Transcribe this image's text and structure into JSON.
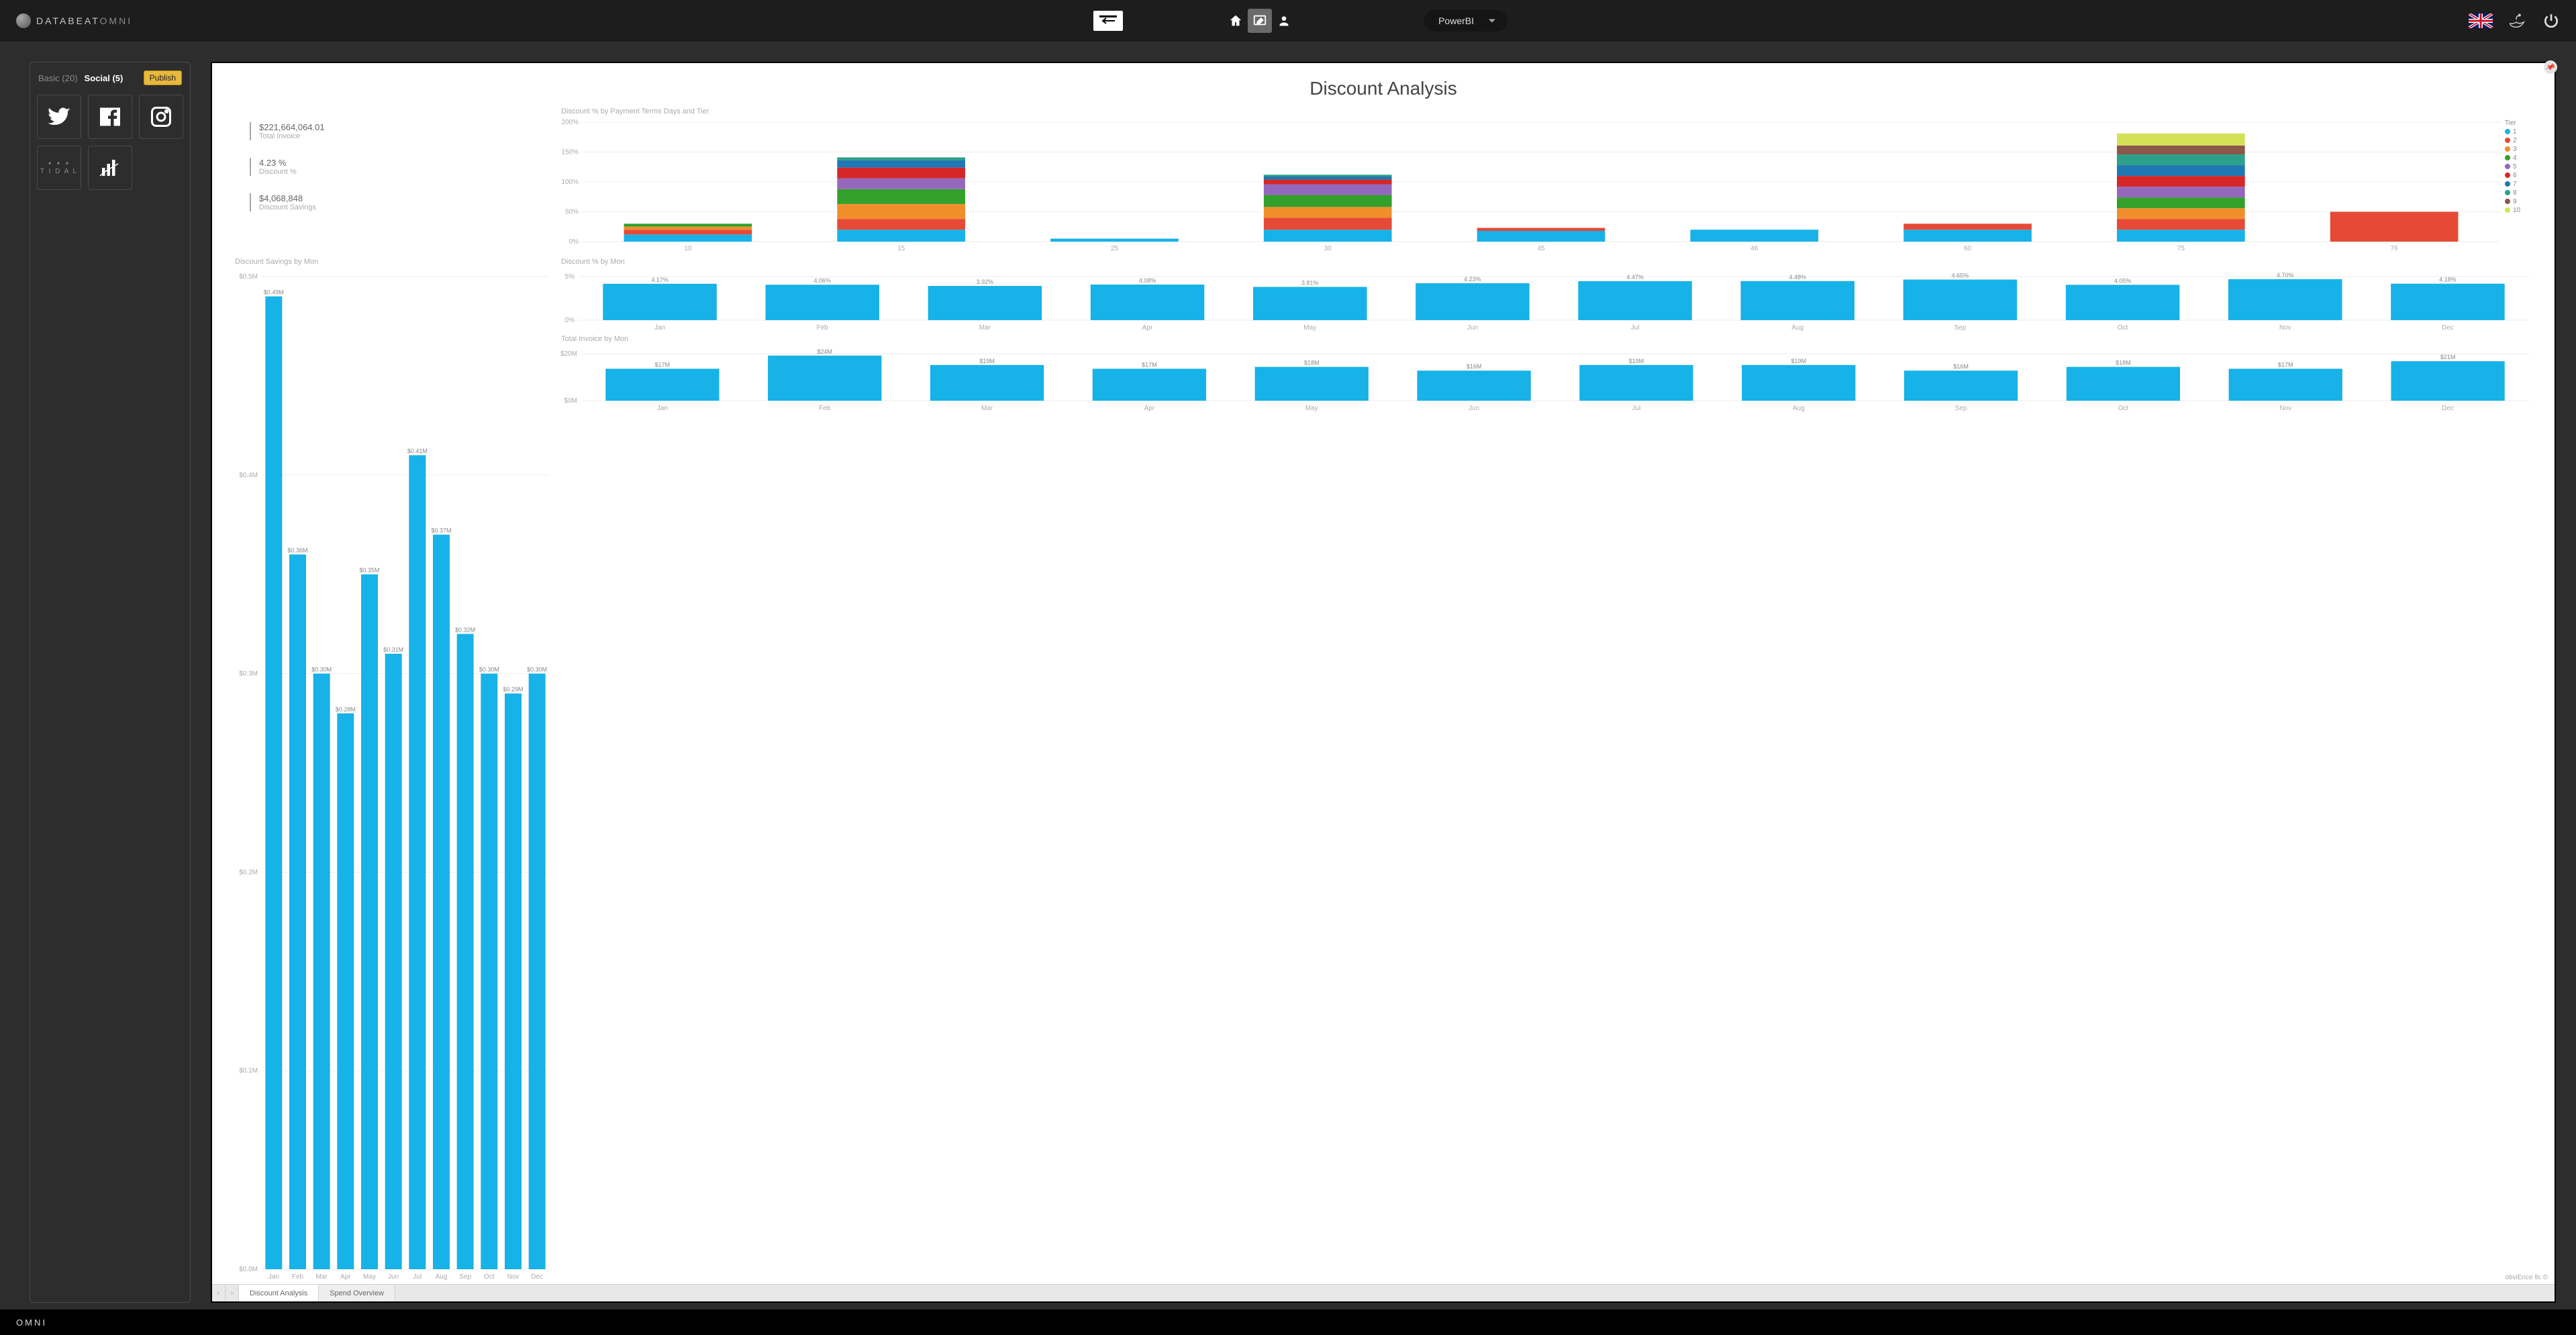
{
  "header": {
    "brand_prefix": "DATABEAT",
    "brand_suffix": "OMNI",
    "app_select": "PowerBI"
  },
  "sidebar": {
    "tabs": [
      {
        "label": "Basic (20)",
        "active": false
      },
      {
        "label": "Social (5)",
        "active": true
      }
    ],
    "publish": "Publish",
    "tiles": [
      "twitter",
      "facebook",
      "instagram",
      "tidal",
      "powerbi"
    ]
  },
  "report": {
    "title": "Discount Analysis",
    "tabs": [
      {
        "label": "Discount Analysis",
        "active": true
      },
      {
        "label": "Spend Overview",
        "active": false
      }
    ],
    "copyright": "obviEnce llc ©"
  },
  "kpis": {
    "total_invoice": {
      "value": "$221,664,064.01",
      "label": "Total Invoice"
    },
    "discount_pct": {
      "value": "4.23 %",
      "label": "Discount %"
    },
    "discount_savings": {
      "value": "$4,068,848",
      "label": "Discount Savings"
    }
  },
  "chart_data": [
    {
      "id": "discount_savings_by_mon",
      "type": "bar",
      "title": "Discount Savings by Mon",
      "categories": [
        "Jan",
        "Feb",
        "Mar",
        "Apr",
        "May",
        "Jun",
        "Jul",
        "Aug",
        "Sep",
        "Oct",
        "Nov",
        "Dec"
      ],
      "values": [
        0.49,
        0.36,
        0.3,
        0.28,
        0.35,
        0.31,
        0.41,
        0.37,
        0.32,
        0.3,
        0.29,
        0.3
      ],
      "value_labels": [
        "$0.49M",
        "$0.36M",
        "$0.30M",
        "$0.28M",
        "$0.35M",
        "$0.31M",
        "$0.41M",
        "$0.37M",
        "$0.32M",
        "$0.30M",
        "$0.29M",
        "$0.30M"
      ],
      "ylabel": "",
      "xlabel": "",
      "ylim": [
        0,
        0.5
      ],
      "yticks": [
        "$0.0M",
        "$0.1M",
        "$0.2M",
        "$0.3M",
        "$0.4M",
        "$0.5M"
      ]
    },
    {
      "id": "discount_pct_by_terms_tier",
      "type": "stacked-bar",
      "title": "Discount % by Payment Terms Days and Tier",
      "categories": [
        "10",
        "15",
        "25",
        "30",
        "45",
        "46",
        "60",
        "75",
        "76"
      ],
      "legend_title": "Tier",
      "ylim": [
        0,
        200
      ],
      "yticks": [
        "0%",
        "50%",
        "100%",
        "150%",
        "200%"
      ],
      "tier_colors": {
        "1": "#17b2e7",
        "2": "#e64a36",
        "3": "#f18e2c",
        "4": "#33a02c",
        "5": "#9467bd",
        "6": "#d62728",
        "7": "#1f77b4",
        "8": "#2ca089",
        "9": "#8c564b",
        "10": "#d4e157"
      },
      "series": [
        {
          "name": "1",
          "values": [
            12,
            20,
            5,
            20,
            18,
            20,
            20,
            20,
            0
          ]
        },
        {
          "name": "2",
          "values": [
            8,
            18,
            0,
            20,
            5,
            0,
            10,
            18,
            50
          ]
        },
        {
          "name": "3",
          "values": [
            5,
            25,
            0,
            18,
            0,
            0,
            0,
            18,
            0
          ]
        },
        {
          "name": "4",
          "values": [
            5,
            25,
            0,
            20,
            0,
            0,
            0,
            18,
            0
          ]
        },
        {
          "name": "5",
          "values": [
            0,
            18,
            0,
            18,
            0,
            0,
            0,
            18,
            0
          ]
        },
        {
          "name": "6",
          "values": [
            0,
            18,
            0,
            8,
            0,
            0,
            0,
            18,
            0
          ]
        },
        {
          "name": "7",
          "values": [
            0,
            12,
            0,
            5,
            0,
            0,
            0,
            18,
            0
          ]
        },
        {
          "name": "8",
          "values": [
            0,
            5,
            0,
            3,
            0,
            0,
            0,
            18,
            0
          ]
        },
        {
          "name": "9",
          "values": [
            0,
            0,
            0,
            0,
            0,
            0,
            0,
            15,
            0
          ]
        },
        {
          "name": "10",
          "values": [
            0,
            0,
            0,
            0,
            0,
            0,
            0,
            20,
            0
          ]
        }
      ]
    },
    {
      "id": "discount_pct_by_mon",
      "type": "bar",
      "title": "Discount % by Mon",
      "categories": [
        "Jan",
        "Feb",
        "Mar",
        "Apr",
        "May",
        "Jun",
        "Jul",
        "Aug",
        "Sep",
        "Oct",
        "Nov",
        "Dec"
      ],
      "values": [
        4.17,
        4.06,
        3.92,
        4.08,
        3.81,
        4.23,
        4.47,
        4.48,
        4.65,
        4.05,
        4.7,
        4.18
      ],
      "value_labels": [
        "4.17%",
        "4.06%",
        "3.92%",
        "4.08%",
        "3.81%",
        "4.23%",
        "4.47%",
        "4.48%",
        "4.65%",
        "4.05%",
        "4.70%",
        "4.18%"
      ],
      "ylim": [
        0,
        5
      ],
      "yticks": [
        "0%",
        "5%"
      ]
    },
    {
      "id": "total_invoice_by_mon",
      "type": "bar",
      "title": "Total Invoice by Mon",
      "categories": [
        "Jan",
        "Feb",
        "Mar",
        "Apr",
        "May",
        "Jun",
        "Jul",
        "Aug",
        "Sep",
        "Oct",
        "Nov",
        "Dec"
      ],
      "values": [
        17,
        24,
        19,
        17,
        18,
        16,
        19,
        19,
        16,
        18,
        17,
        21
      ],
      "value_labels": [
        "$17M",
        "$24M",
        "$19M",
        "$17M",
        "$18M",
        "$16M",
        "$19M",
        "$19M",
        "$16M",
        "$18M",
        "$17M",
        "$21M"
      ],
      "ylim": [
        0,
        25
      ],
      "yticks": [
        "$0M",
        "$20M"
      ]
    }
  ],
  "footer": {
    "brand": "OMNI"
  }
}
